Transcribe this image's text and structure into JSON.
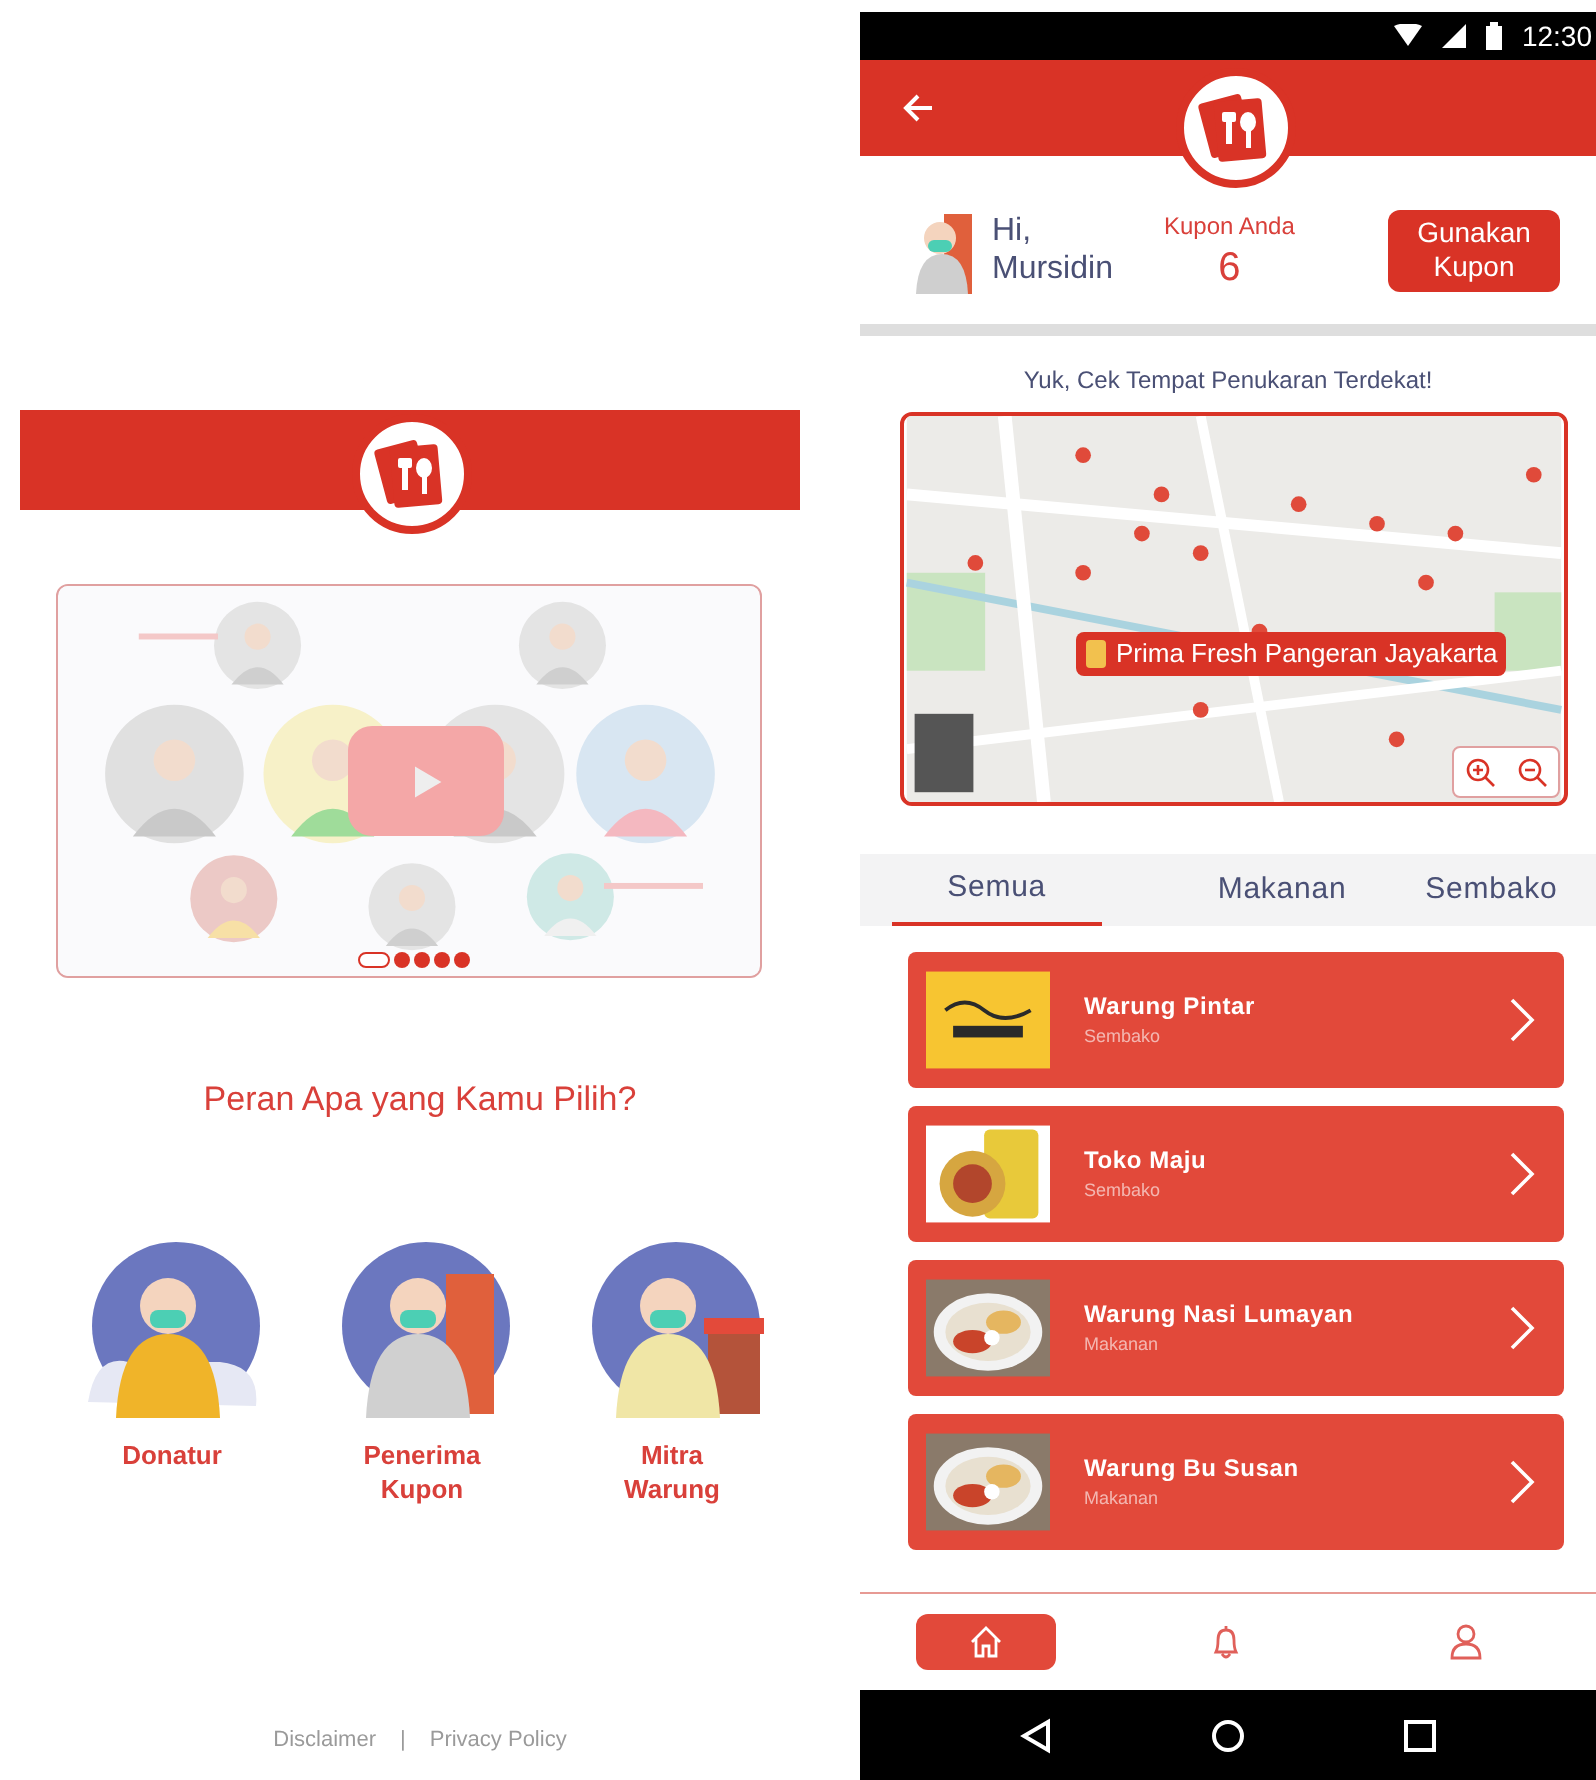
{
  "role_screen": {
    "carousel_dots": [
      {
        "selected": true
      },
      {
        "selected": false
      },
      {
        "selected": false
      },
      {
        "selected": false
      },
      {
        "selected": false
      }
    ],
    "heading": "Peran Apa yang Kamu Pilih?",
    "roles": [
      {
        "kind": "donor",
        "label": "Donatur"
      },
      {
        "kind": "recipient",
        "label": "Penerima Kupon"
      },
      {
        "kind": "vendor",
        "label": "Mitra Warung"
      }
    ],
    "footer_links": [
      "Disclaimer",
      "Privacy Policy"
    ],
    "footer_separator": "|"
  },
  "home_screen": {
    "status_bar": {
      "time": "12:30"
    },
    "greeting": "Hi, Mursidin",
    "coupon_label": "Kupon Anda",
    "coupon_count": "6",
    "use_coupon_button": "Gunakan Kupon",
    "map_heading": "Yuk, Cek Tempat Penukaran Terdekat!",
    "map_callout": "Prima Fresh Pangeran Jayakarta",
    "tabs": [
      {
        "label": "Semua",
        "selected": true
      },
      {
        "label": "Makanan",
        "selected": false
      },
      {
        "label": "Sembako",
        "selected": false
      }
    ],
    "stores": [
      {
        "name": "Warung Pintar",
        "category": "Sembako",
        "kind": "logo"
      },
      {
        "name": "Toko Maju",
        "category": "Sembako",
        "kind": "groceries"
      },
      {
        "name": "Warung Nasi Lumayan",
        "category": "Makanan",
        "kind": "food"
      },
      {
        "name": "Warung Bu Susan",
        "category": "Makanan",
        "kind": "food"
      }
    ],
    "bottom_nav": [
      {
        "kind": "home",
        "selected": true
      },
      {
        "kind": "bell",
        "selected": false
      },
      {
        "kind": "user",
        "selected": false
      }
    ]
  }
}
